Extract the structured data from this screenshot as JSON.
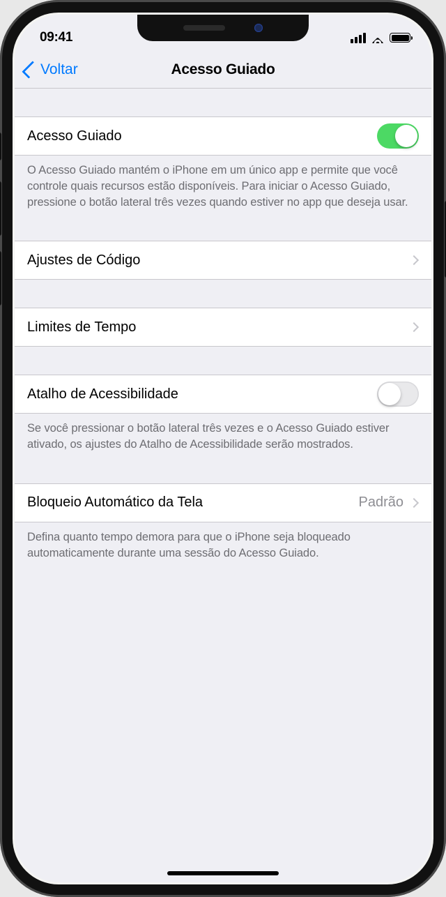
{
  "status": {
    "time": "09:41"
  },
  "nav": {
    "back": "Voltar",
    "title": "Acesso Guiado"
  },
  "rows": {
    "guided_access": {
      "label": "Acesso Guiado",
      "on": true
    },
    "guided_access_footer": "O Acesso Guiado mantém o iPhone em um único app e permite que você controle quais recursos estão disponíveis. Para iniciar o Acesso Guiado, pressione o botão lateral três vezes quando estiver no app que deseja usar.",
    "passcode": {
      "label": "Ajustes de Código"
    },
    "time_limits": {
      "label": "Limites de Tempo"
    },
    "accessibility_shortcut": {
      "label": "Atalho de Acessibilidade",
      "on": false
    },
    "accessibility_footer": "Se você pressionar o botão lateral três vezes e o Acesso Guiado estiver ativado, os ajustes do Atalho de Acessibilidade serão mostrados.",
    "auto_lock": {
      "label": "Bloqueio Automático da Tela",
      "value": "Padrão"
    },
    "auto_lock_footer": "Defina quanto tempo demora para que o iPhone seja bloqueado automaticamente durante uma sessão do Acesso Guiado."
  }
}
